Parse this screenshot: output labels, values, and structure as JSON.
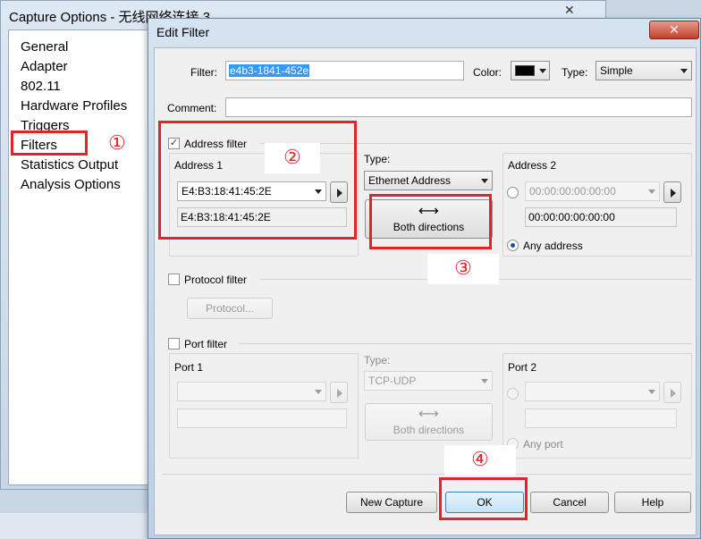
{
  "background_window": {
    "title": "Capture Options - 无线网络连接 3",
    "close_glyph": "✕",
    "nav_items": [
      "General",
      "Adapter",
      "802.11",
      "Hardware Profiles",
      "Triggers",
      "Filters",
      "Statistics Output",
      "Analysis Options"
    ]
  },
  "dialog": {
    "title": "Edit Filter",
    "close_glyph": "✕",
    "filter_label": "Filter:",
    "filter_value": "e4b3-1841-452e",
    "color_label": "Color:",
    "color_value": "#000000",
    "type_label": "Type:",
    "type_value": "Simple",
    "comment_label": "Comment:",
    "comment_value": "",
    "address_filter": {
      "checkbox_label": "Address filter",
      "checked": true,
      "address1_label": "Address 1",
      "address1_value": "E4:B3:18:41:45:2E",
      "address1_readonly": "E4:B3:18:41:45:2E",
      "type_label": "Type:",
      "type_value": "Ethernet Address",
      "direction_icon": "⟷",
      "direction_label": "Both directions",
      "address2_label": "Address 2",
      "address2_value": "00:00:00:00:00:00",
      "address2_readonly": "00:00:00:00:00:00",
      "any_address_label": "Any address"
    },
    "protocol_filter": {
      "checkbox_label": "Protocol filter",
      "checked": false,
      "protocol_button": "Protocol..."
    },
    "port_filter": {
      "checkbox_label": "Port filter",
      "checked": false,
      "port1_label": "Port 1",
      "type_label": "Type:",
      "type_value": "TCP-UDP",
      "direction_icon": "⟷",
      "direction_label": "Both directions",
      "port2_label": "Port 2",
      "any_port_label": "Any port"
    },
    "buttons": {
      "new_capture": "New Capture",
      "ok": "OK",
      "cancel": "Cancel",
      "help": "Help"
    }
  },
  "annotations": [
    "①",
    "②",
    "③",
    "④"
  ],
  "colors": {
    "annotation_red": "#e0242b",
    "selection_blue": "#3399ff"
  }
}
